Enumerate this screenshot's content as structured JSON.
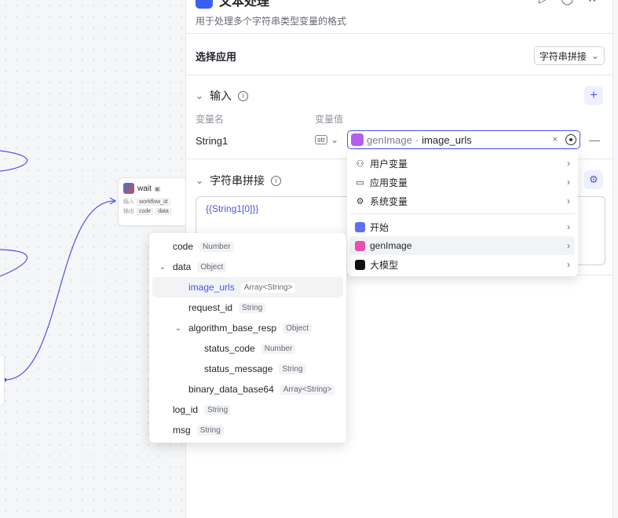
{
  "canvas": {
    "wait_node": {
      "title": "wait",
      "input_label": "输入",
      "input_tag": "workflow_id",
      "output_label": "输出",
      "output_tags": [
        "code",
        "data"
      ]
    }
  },
  "panel": {
    "title": "文本处理",
    "description": "用于处理多个字符串类型变量的格式",
    "select_app": {
      "label": "选择应用",
      "value": "字符串拼接"
    },
    "input_section": {
      "title": "输入",
      "col_name": "变量名",
      "col_value": "变量值",
      "row": {
        "name": "String1",
        "type": "str",
        "node": "genImage",
        "separator": "·",
        "variable": "image_urls",
        "clear": "×"
      }
    },
    "concat_section": {
      "title": "字符串拼接",
      "template": "{{String1[0]}}"
    }
  },
  "menu": {
    "items": [
      {
        "label": "用户变量",
        "icon": "user-icon"
      },
      {
        "label": "应用变量",
        "icon": "folder-icon"
      },
      {
        "label": "系统变量",
        "icon": "gear-icon"
      },
      {
        "label": "开始",
        "icon": "start-node-icon"
      },
      {
        "label": "genImage",
        "icon": "genimage-node-icon",
        "active": true
      },
      {
        "label": "大模型",
        "icon": "llm-node-icon"
      }
    ]
  },
  "tree": {
    "rows": [
      {
        "name": "code",
        "type": "Number",
        "level": 0,
        "caret": ""
      },
      {
        "name": "data",
        "type": "Object",
        "level": 0,
        "caret": "⌄"
      },
      {
        "name": "image_urls",
        "type": "Array<String>",
        "level": 1,
        "caret": "",
        "active": true
      },
      {
        "name": "request_id",
        "type": "String",
        "level": 1,
        "caret": ""
      },
      {
        "name": "algorithm_base_resp",
        "type": "Object",
        "level": 1,
        "caret": "⌄"
      },
      {
        "name": "status_code",
        "type": "Number",
        "level": 2,
        "caret": ""
      },
      {
        "name": "status_message",
        "type": "String",
        "level": 2,
        "caret": ""
      },
      {
        "name": "binary_data_base64",
        "type": "Array<String>",
        "level": 1,
        "caret": ""
      },
      {
        "name": "log_id",
        "type": "String",
        "level": 0,
        "caret": ""
      },
      {
        "name": "msg",
        "type": "String",
        "level": 0,
        "caret": ""
      }
    ]
  }
}
